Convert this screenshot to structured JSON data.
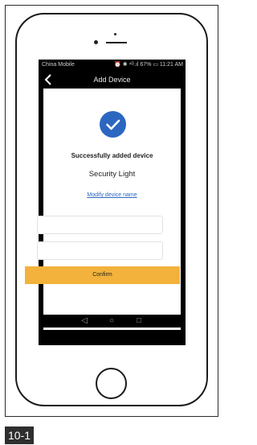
{
  "status_bar": {
    "carrier": "China Mobile",
    "indicators": "⏰ ✱ ⁴ᴳ.ıl 67% ▭ 11:21 AM"
  },
  "nav": {
    "back_icon": "chevron-left-icon",
    "title": "Add Device"
  },
  "result": {
    "check_icon": "checkmark-circle-icon",
    "message": "Successfully added device",
    "device_name": "Security Light",
    "modify_link": "Modify device name"
  },
  "fields": [
    {
      "value": "",
      "placeholder": ""
    },
    {
      "value": "",
      "placeholder": ""
    }
  ],
  "confirm_button": "Confirm",
  "system_nav": {
    "back": "◁",
    "home": "○",
    "recents": "□"
  },
  "figure_label": "10-1",
  "colors": {
    "accent_blue": "#2b67c0",
    "confirm_orange": "#f3b23c"
  }
}
